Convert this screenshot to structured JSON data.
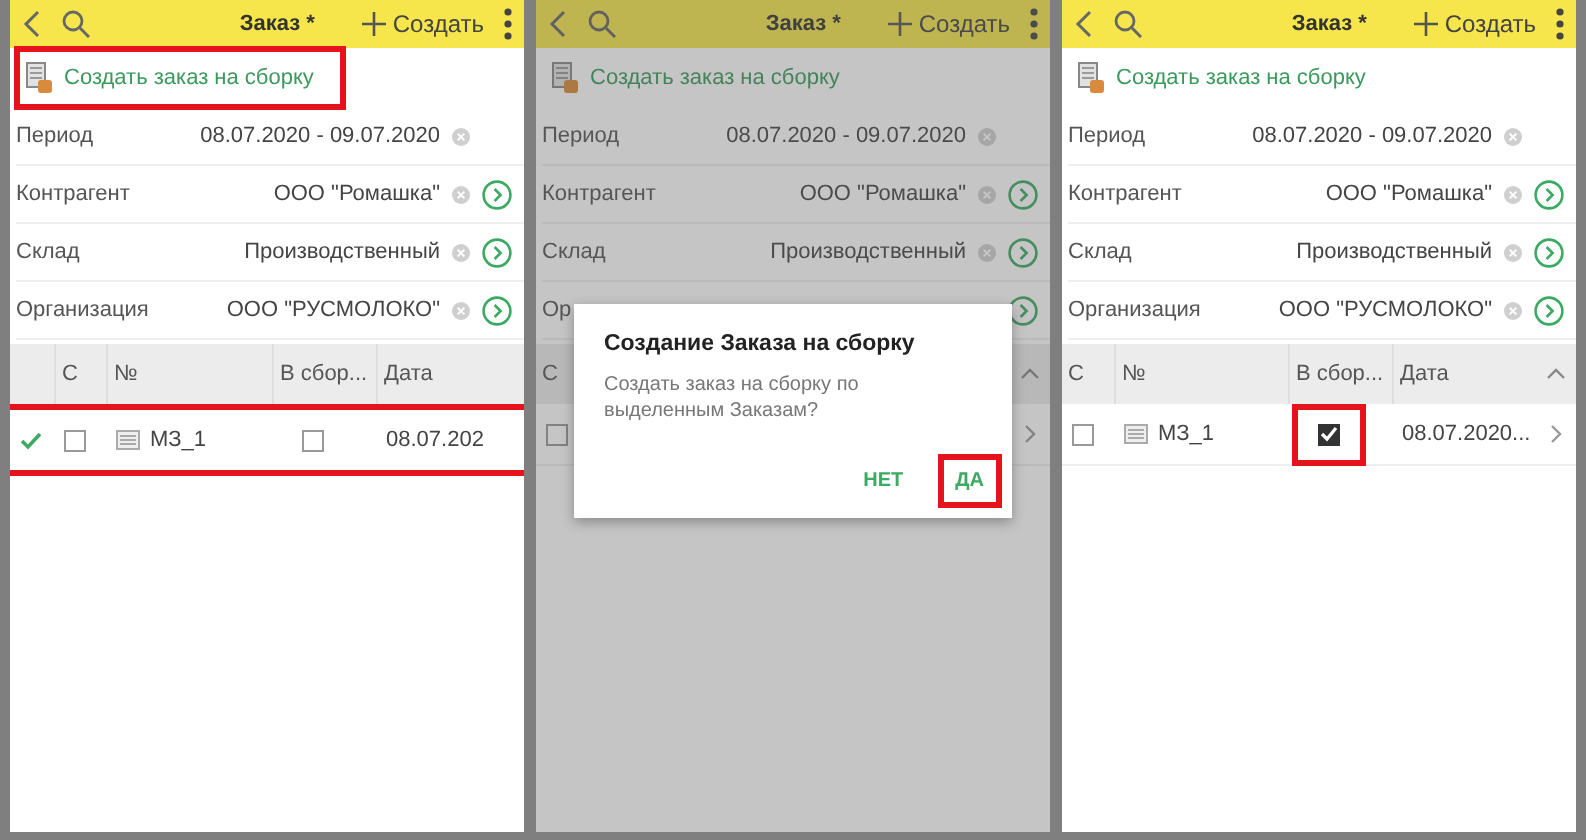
{
  "panels": [
    {
      "title": "Заказ *",
      "create_label": "Создать",
      "dimmed": false,
      "action": {
        "label": "Создать заказ на сборку",
        "highlighted": true
      },
      "fields": [
        {
          "label": "Период",
          "value": "08.07.2020 - 09.07.2020",
          "clear": true,
          "open": false
        },
        {
          "label": "Контрагент",
          "value": "ООО \"Ромашка\"",
          "clear": true,
          "open": true
        },
        {
          "label": "Склад",
          "value": "Производственный",
          "clear": true,
          "open": true
        },
        {
          "label": "Организация",
          "value": "ООО \"РУСМОЛОКО\"",
          "clear": true,
          "open": true
        }
      ],
      "table": {
        "columns": [
          {
            "kind": "mark"
          },
          {
            "kind": "check",
            "label": "С"
          },
          {
            "kind": "number",
            "label": "№"
          },
          {
            "kind": "assembly",
            "label": "В сбор..."
          },
          {
            "kind": "date",
            "label": "Дата"
          }
        ],
        "sort_indicator": false,
        "rows": [
          {
            "marked": true,
            "c_checked": false,
            "number": "МЗ_1",
            "in_assembly": false,
            "date": "08.07.202",
            "chevron": false,
            "highlighted": true,
            "assembly_highlighted": false
          }
        ]
      }
    },
    {
      "title": "Заказ *",
      "create_label": "Создать",
      "dimmed": true,
      "action": {
        "label": "Создать заказ на сборку",
        "highlighted": false
      },
      "fields": [
        {
          "label": "Период",
          "value": "08.07.2020 - 09.07.2020",
          "clear": true,
          "open": false
        },
        {
          "label": "Контрагент",
          "value": "ООО \"Ромашка\"",
          "clear": true,
          "open": true
        },
        {
          "label": "Склад",
          "value": "Производственный",
          "clear": true,
          "open": true
        },
        {
          "label": "Ор",
          "clear": false,
          "open": true
        }
      ],
      "table": {
        "columns": [
          {
            "kind": "check",
            "label": "С"
          }
        ],
        "sort_indicator": true,
        "rows": [
          {
            "c_checked": false,
            "chevron": true,
            "highlighted": false
          }
        ]
      },
      "dialog": {
        "title": "Создание Заказа на сборку",
        "text": "Создать заказ на сборку по выделенным Заказам?",
        "buttons": [
          {
            "label": "НЕТ",
            "highlighted": false
          },
          {
            "label": "ДА",
            "highlighted": true
          }
        ]
      }
    },
    {
      "title": "Заказ *",
      "create_label": "Создать",
      "dimmed": false,
      "action": {
        "label": "Создать заказ на сборку",
        "highlighted": false
      },
      "fields": [
        {
          "label": "Период",
          "value": "08.07.2020 - 09.07.2020",
          "clear": true,
          "open": false
        },
        {
          "label": "Контрагент",
          "value": "ООО \"Ромашка\"",
          "clear": true,
          "open": true
        },
        {
          "label": "Склад",
          "value": "Производственный",
          "clear": true,
          "open": true
        },
        {
          "label": "Организация",
          "value": "ООО \"РУСМОЛОКО\"",
          "clear": true,
          "open": true
        }
      ],
      "table": {
        "columns": [
          {
            "kind": "check",
            "label": "С"
          },
          {
            "kind": "number",
            "label": "№"
          },
          {
            "kind": "assembly",
            "label": "В сбор..."
          },
          {
            "kind": "date",
            "label": "Дата"
          }
        ],
        "sort_indicator": true,
        "rows": [
          {
            "c_checked": false,
            "number": "МЗ_1",
            "in_assembly": true,
            "date": "08.07.2020...",
            "chevron": true,
            "highlighted": false,
            "assembly_highlighted": true
          }
        ]
      }
    }
  ]
}
